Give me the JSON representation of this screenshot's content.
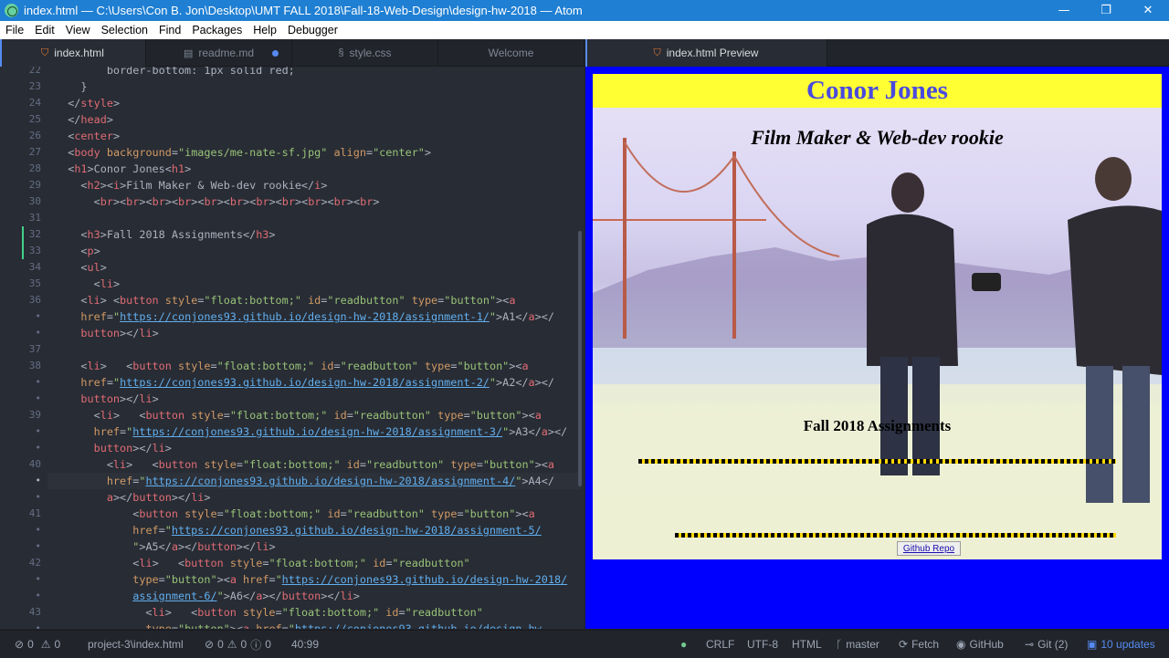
{
  "window": {
    "title": "index.html — C:\\Users\\Con B. Jon\\Desktop\\UMT FALL 2018\\Fall-18-Web-Design\\design-hw-2018 — Atom",
    "minimize": "—",
    "maximize": "❐",
    "close": "✕"
  },
  "menu": [
    "File",
    "Edit",
    "View",
    "Selection",
    "Find",
    "Packages",
    "Help",
    "Debugger"
  ],
  "tabs": [
    {
      "label": "index.html",
      "icon": "html5-icon"
    },
    {
      "label": "readme.md",
      "icon": "book-icon"
    },
    {
      "label": "style.css",
      "icon": "file-code-icon"
    },
    {
      "label": "Welcome",
      "icon": ""
    }
  ],
  "preview_tab": {
    "label": "index.html Preview"
  },
  "editor": {
    "line_numbers": [
      "22",
      "23",
      "24",
      "25",
      "26",
      "27",
      "28",
      "29",
      "30",
      "31",
      "32",
      "33",
      "34",
      "35",
      "36",
      "•",
      "•",
      "37",
      "38",
      "•",
      "•",
      "39",
      "•",
      "•",
      "40",
      "•",
      "•",
      "41",
      "•",
      "•",
      "42",
      "•",
      "•",
      "43",
      "•"
    ],
    "lines": [
      [
        [
          "pl",
          "        border-bottom: 1px solid red;"
        ]
      ],
      [
        [
          "pl",
          "    }"
        ]
      ],
      [
        [
          "pl",
          "  </"
        ],
        [
          "tg",
          "style"
        ],
        [
          "pl",
          ">"
        ]
      ],
      [
        [
          "pl",
          "  </"
        ],
        [
          "tg",
          "head"
        ],
        [
          "pl",
          ">"
        ]
      ],
      [
        [
          "pl",
          "  <"
        ],
        [
          "tg",
          "center"
        ],
        [
          "pl",
          ">"
        ]
      ],
      [
        [
          "pl",
          "  <"
        ],
        [
          "tg",
          "body"
        ],
        [
          "pl",
          " "
        ],
        [
          "at",
          "background"
        ],
        [
          "pl",
          "="
        ],
        [
          "st",
          "\"images/me-nate-sf.jpg\""
        ],
        [
          "pl",
          " "
        ],
        [
          "at",
          "align"
        ],
        [
          "pl",
          "="
        ],
        [
          "st",
          "\"center\""
        ],
        [
          "pl",
          ">"
        ]
      ],
      [
        [
          "pl",
          "  <"
        ],
        [
          "tg",
          "h1"
        ],
        [
          "pl",
          ">Conor Jones<"
        ],
        [
          "tg",
          "h1"
        ],
        [
          "pl",
          ">"
        ]
      ],
      [
        [
          "pl",
          "    <"
        ],
        [
          "tg",
          "h2"
        ],
        [
          "pl",
          "><"
        ],
        [
          "tg",
          "i"
        ],
        [
          "pl",
          ">Film Maker & Web-dev rookie</"
        ],
        [
          "tg",
          "i"
        ],
        [
          "pl",
          ">"
        ]
      ],
      [
        [
          "pl",
          "      <"
        ],
        [
          "tg",
          "br"
        ],
        [
          "pl",
          "><"
        ],
        [
          "tg",
          "br"
        ],
        [
          "pl",
          "><"
        ],
        [
          "tg",
          "br"
        ],
        [
          "pl",
          "><"
        ],
        [
          "tg",
          "br"
        ],
        [
          "pl",
          "><"
        ],
        [
          "tg",
          "br"
        ],
        [
          "pl",
          "><"
        ],
        [
          "tg",
          "br"
        ],
        [
          "pl",
          "><"
        ],
        [
          "tg",
          "br"
        ],
        [
          "pl",
          "><"
        ],
        [
          "tg",
          "br"
        ],
        [
          "pl",
          "><"
        ],
        [
          "tg",
          "br"
        ],
        [
          "pl",
          "><"
        ],
        [
          "tg",
          "br"
        ],
        [
          "pl",
          "><"
        ],
        [
          "tg",
          "br"
        ],
        [
          "pl",
          ">"
        ]
      ],
      [
        [
          "pl",
          ""
        ]
      ],
      [
        [
          "pl",
          "    <"
        ],
        [
          "tg",
          "h3"
        ],
        [
          "pl",
          ">Fall 2018 Assignments</"
        ],
        [
          "tg",
          "h3"
        ],
        [
          "pl",
          ">"
        ]
      ],
      [
        [
          "pl",
          "    <"
        ],
        [
          "tg",
          "p"
        ],
        [
          "pl",
          ">"
        ]
      ],
      [
        [
          "pl",
          "    <"
        ],
        [
          "tg",
          "ul"
        ],
        [
          "pl",
          ">"
        ]
      ],
      [
        [
          "pl",
          "      <"
        ],
        [
          "tg",
          "li"
        ],
        [
          "pl",
          ">"
        ]
      ],
      [
        [
          "pl",
          "    <"
        ],
        [
          "tg",
          "li"
        ],
        [
          "pl",
          "> <"
        ],
        [
          "tg",
          "button"
        ],
        [
          "pl",
          " "
        ],
        [
          "at",
          "style"
        ],
        [
          "pl",
          "="
        ],
        [
          "st",
          "\"float:bottom;\""
        ],
        [
          "pl",
          " "
        ],
        [
          "at",
          "id"
        ],
        [
          "pl",
          "="
        ],
        [
          "st",
          "\"readbutton\""
        ],
        [
          "pl",
          " "
        ],
        [
          "at",
          "type"
        ],
        [
          "pl",
          "="
        ],
        [
          "st",
          "\"button\""
        ],
        [
          "pl",
          "><"
        ],
        [
          "tg",
          "a"
        ]
      ],
      [
        [
          "pl",
          "    "
        ],
        [
          "at",
          "href"
        ],
        [
          "pl",
          "="
        ],
        [
          "st",
          "\""
        ],
        [
          "ul",
          "https://conjones93.github.io/design-hw-2018/assignment-1/"
        ],
        [
          "st",
          "\""
        ],
        [
          "pl",
          ">A1</"
        ],
        [
          "tg",
          "a"
        ],
        [
          "pl",
          "></"
        ]
      ],
      [
        [
          "pl",
          "    "
        ],
        [
          "tg",
          "button"
        ],
        [
          "pl",
          "></"
        ],
        [
          "tg",
          "li"
        ],
        [
          "pl",
          ">"
        ]
      ],
      [
        [
          "pl",
          ""
        ]
      ],
      [
        [
          "pl",
          "    <"
        ],
        [
          "tg",
          "li"
        ],
        [
          "pl",
          ">   <"
        ],
        [
          "tg",
          "button"
        ],
        [
          "pl",
          " "
        ],
        [
          "at",
          "style"
        ],
        [
          "pl",
          "="
        ],
        [
          "st",
          "\"float:bottom;\""
        ],
        [
          "pl",
          " "
        ],
        [
          "at",
          "id"
        ],
        [
          "pl",
          "="
        ],
        [
          "st",
          "\"readbutton\""
        ],
        [
          "pl",
          " "
        ],
        [
          "at",
          "type"
        ],
        [
          "pl",
          "="
        ],
        [
          "st",
          "\"button\""
        ],
        [
          "pl",
          "><"
        ],
        [
          "tg",
          "a"
        ]
      ],
      [
        [
          "pl",
          "    "
        ],
        [
          "at",
          "href"
        ],
        [
          "pl",
          "="
        ],
        [
          "st",
          "\""
        ],
        [
          "ul",
          "https://conjones93.github.io/design-hw-2018/assignment-2/"
        ],
        [
          "st",
          "\""
        ],
        [
          "pl",
          ">A2</"
        ],
        [
          "tg",
          "a"
        ],
        [
          "pl",
          "></"
        ]
      ],
      [
        [
          "pl",
          "    "
        ],
        [
          "tg",
          "button"
        ],
        [
          "pl",
          "></"
        ],
        [
          "tg",
          "li"
        ],
        [
          "pl",
          ">"
        ]
      ],
      [
        [
          "pl",
          "      <"
        ],
        [
          "tg",
          "li"
        ],
        [
          "pl",
          ">   <"
        ],
        [
          "tg",
          "button"
        ],
        [
          "pl",
          " "
        ],
        [
          "at",
          "style"
        ],
        [
          "pl",
          "="
        ],
        [
          "st",
          "\"float:bottom;\""
        ],
        [
          "pl",
          " "
        ],
        [
          "at",
          "id"
        ],
        [
          "pl",
          "="
        ],
        [
          "st",
          "\"readbutton\""
        ],
        [
          "pl",
          " "
        ],
        [
          "at",
          "type"
        ],
        [
          "pl",
          "="
        ],
        [
          "st",
          "\"button\""
        ],
        [
          "pl",
          "><"
        ],
        [
          "tg",
          "a"
        ]
      ],
      [
        [
          "pl",
          "      "
        ],
        [
          "at",
          "href"
        ],
        [
          "pl",
          "="
        ],
        [
          "st",
          "\""
        ],
        [
          "ul",
          "https://conjones93.github.io/design-hw-2018/assignment-3/"
        ],
        [
          "st",
          "\""
        ],
        [
          "pl",
          ">A3</"
        ],
        [
          "tg",
          "a"
        ],
        [
          "pl",
          "></"
        ]
      ],
      [
        [
          "pl",
          "      "
        ],
        [
          "tg",
          "button"
        ],
        [
          "pl",
          "></"
        ],
        [
          "tg",
          "li"
        ],
        [
          "pl",
          ">"
        ]
      ],
      [
        [
          "pl",
          "        <"
        ],
        [
          "tg",
          "li"
        ],
        [
          "pl",
          ">   <"
        ],
        [
          "tg",
          "button"
        ],
        [
          "pl",
          " "
        ],
        [
          "at",
          "style"
        ],
        [
          "pl",
          "="
        ],
        [
          "st",
          "\"float:bottom;\""
        ],
        [
          "pl",
          " "
        ],
        [
          "at",
          "id"
        ],
        [
          "pl",
          "="
        ],
        [
          "st",
          "\"readbutton\""
        ],
        [
          "pl",
          " "
        ],
        [
          "at",
          "type"
        ],
        [
          "pl",
          "="
        ],
        [
          "st",
          "\"button\""
        ],
        [
          "pl",
          "><"
        ],
        [
          "tg",
          "a"
        ]
      ],
      [
        [
          "pl",
          "        "
        ],
        [
          "at",
          "href"
        ],
        [
          "pl",
          "="
        ],
        [
          "st",
          "\""
        ],
        [
          "ul",
          "https://conjones93.github.io/design-hw-2018/assignment-4/"
        ],
        [
          "st",
          "\""
        ],
        [
          "pl",
          ">A4</"
        ]
      ],
      [
        [
          "pl",
          "        "
        ],
        [
          "tg",
          "a"
        ],
        [
          "pl",
          "></"
        ],
        [
          "tg",
          "button"
        ],
        [
          "pl",
          "></"
        ],
        [
          "tg",
          "li"
        ],
        [
          "pl",
          ">"
        ]
      ],
      [
        [
          "pl",
          "            <"
        ],
        [
          "tg",
          "button"
        ],
        [
          "pl",
          " "
        ],
        [
          "at",
          "style"
        ],
        [
          "pl",
          "="
        ],
        [
          "st",
          "\"float:bottom;\""
        ],
        [
          "pl",
          " "
        ],
        [
          "at",
          "id"
        ],
        [
          "pl",
          "="
        ],
        [
          "st",
          "\"readbutton\""
        ],
        [
          "pl",
          " "
        ],
        [
          "at",
          "type"
        ],
        [
          "pl",
          "="
        ],
        [
          "st",
          "\"button\""
        ],
        [
          "pl",
          "><"
        ],
        [
          "tg",
          "a"
        ]
      ],
      [
        [
          "pl",
          "            "
        ],
        [
          "at",
          "href"
        ],
        [
          "pl",
          "="
        ],
        [
          "st",
          "\""
        ],
        [
          "ul",
          "https://conjones93.github.io/design-hw-2018/assignment-5/"
        ]
      ],
      [
        [
          "pl",
          "            "
        ],
        [
          "st",
          "\""
        ],
        [
          "pl",
          ">A5</"
        ],
        [
          "tg",
          "a"
        ],
        [
          "pl",
          "></"
        ],
        [
          "tg",
          "button"
        ],
        [
          "pl",
          "></"
        ],
        [
          "tg",
          "li"
        ],
        [
          "pl",
          ">"
        ]
      ],
      [
        [
          "pl",
          "            <"
        ],
        [
          "tg",
          "li"
        ],
        [
          "pl",
          ">   <"
        ],
        [
          "tg",
          "button"
        ],
        [
          "pl",
          " "
        ],
        [
          "at",
          "style"
        ],
        [
          "pl",
          "="
        ],
        [
          "st",
          "\"float:bottom;\""
        ],
        [
          "pl",
          " "
        ],
        [
          "at",
          "id"
        ],
        [
          "pl",
          "="
        ],
        [
          "st",
          "\"readbutton\""
        ]
      ],
      [
        [
          "pl",
          "            "
        ],
        [
          "at",
          "type"
        ],
        [
          "pl",
          "="
        ],
        [
          "st",
          "\"button\""
        ],
        [
          "pl",
          "><"
        ],
        [
          "tg",
          "a"
        ],
        [
          "pl",
          " "
        ],
        [
          "at",
          "href"
        ],
        [
          "pl",
          "="
        ],
        [
          "st",
          "\""
        ],
        [
          "ul",
          "https://conjones93.github.io/design-hw-2018/"
        ]
      ],
      [
        [
          "pl",
          "            "
        ],
        [
          "ul",
          "assignment-6/"
        ],
        [
          "st",
          "\""
        ],
        [
          "pl",
          ">A6</"
        ],
        [
          "tg",
          "a"
        ],
        [
          "pl",
          "></"
        ],
        [
          "tg",
          "button"
        ],
        [
          "pl",
          "></"
        ],
        [
          "tg",
          "li"
        ],
        [
          "pl",
          ">"
        ]
      ],
      [
        [
          "pl",
          "              <"
        ],
        [
          "tg",
          "li"
        ],
        [
          "pl",
          ">   <"
        ],
        [
          "tg",
          "button"
        ],
        [
          "pl",
          " "
        ],
        [
          "at",
          "style"
        ],
        [
          "pl",
          "="
        ],
        [
          "st",
          "\"float:bottom;\""
        ],
        [
          "pl",
          " "
        ],
        [
          "at",
          "id"
        ],
        [
          "pl",
          "="
        ],
        [
          "st",
          "\"readbutton\""
        ]
      ],
      [
        [
          "pl",
          "              "
        ],
        [
          "at",
          "type"
        ],
        [
          "pl",
          "="
        ],
        [
          "st",
          "\"button\""
        ],
        [
          "pl",
          "><"
        ],
        [
          "tg",
          "a"
        ],
        [
          "pl",
          " "
        ],
        [
          "at",
          "href"
        ],
        [
          "pl",
          "="
        ],
        [
          "st",
          "\""
        ],
        [
          "ul",
          "https://conjones93.github.io/design-hw-"
        ]
      ]
    ]
  },
  "preview": {
    "h1": "Conor Jones",
    "h2": "Film Maker & Web-dev rookie",
    "h3": "Fall 2018 Assignments",
    "button": "Github Repo"
  },
  "status": {
    "errors": "0",
    "warnings": "0",
    "path": "project-3\\index.html",
    "lint_errors": "0",
    "lint_warnings": "0",
    "lint_info": "0",
    "cursor": "40:99",
    "line_ending": "CRLF",
    "encoding": "UTF-8",
    "grammar": "HTML",
    "branch": "master",
    "fetch": "Fetch",
    "github": "GitHub",
    "git": "Git (2)",
    "updates": "10 updates"
  },
  "colors": {
    "titlebar": "#1f7fd3",
    "editor_bg": "#282c34",
    "preview_bg": "#0000ff",
    "heading_bar": "#ffff33",
    "heading_text": "#4a4adf",
    "updates_accent": "#568af2"
  }
}
